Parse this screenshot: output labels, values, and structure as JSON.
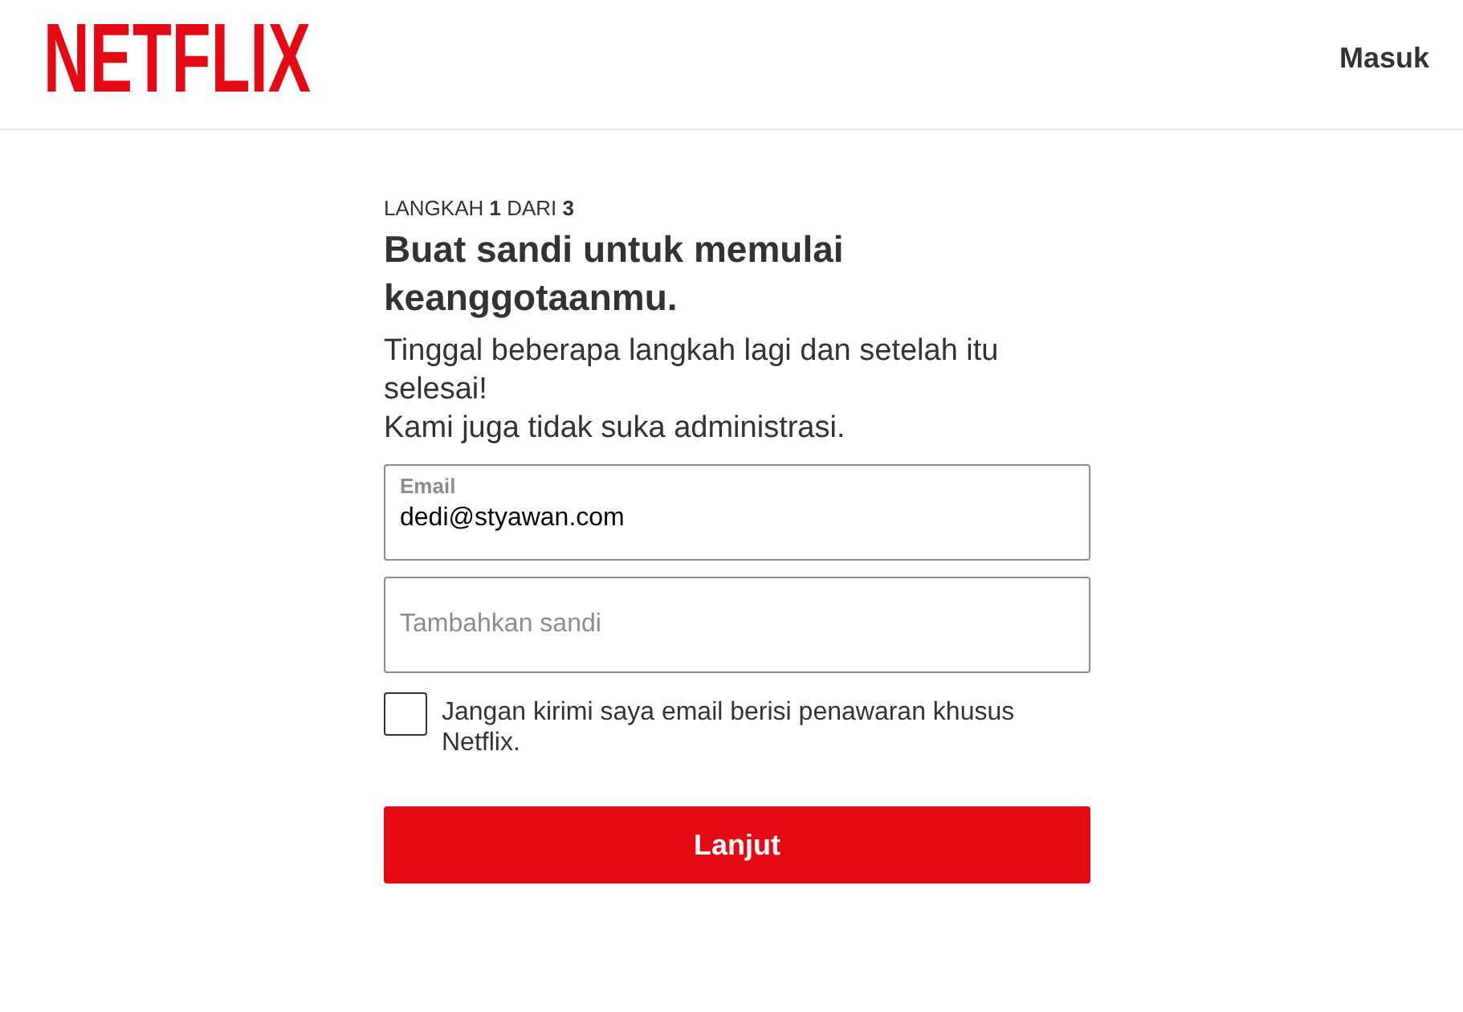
{
  "header": {
    "logo": "NETFLIX",
    "sign_in_link": "Masuk"
  },
  "step": {
    "indicator": "LANGKAH **1** DARI **3**",
    "title": "Buat sandi untuk memulai keanggotaanmu.",
    "description": [
      "Tinggal beberapa langkah lagi dan setelah itu selesai!",
      "Kami juga tidak suka administrasi."
    ]
  },
  "fields": [
    {
      "kind": "email",
      "label": "Email",
      "value": "dedi@styawan.com"
    },
    {
      "kind": "password",
      "placeholder": "Tambahkan sandi"
    }
  ],
  "opt_out": {
    "label": "Jangan kirimi saya email berisi penawaran khusus Netflix.",
    "checked": false
  },
  "buttons": [
    {
      "label": "Lanjut"
    }
  ]
}
